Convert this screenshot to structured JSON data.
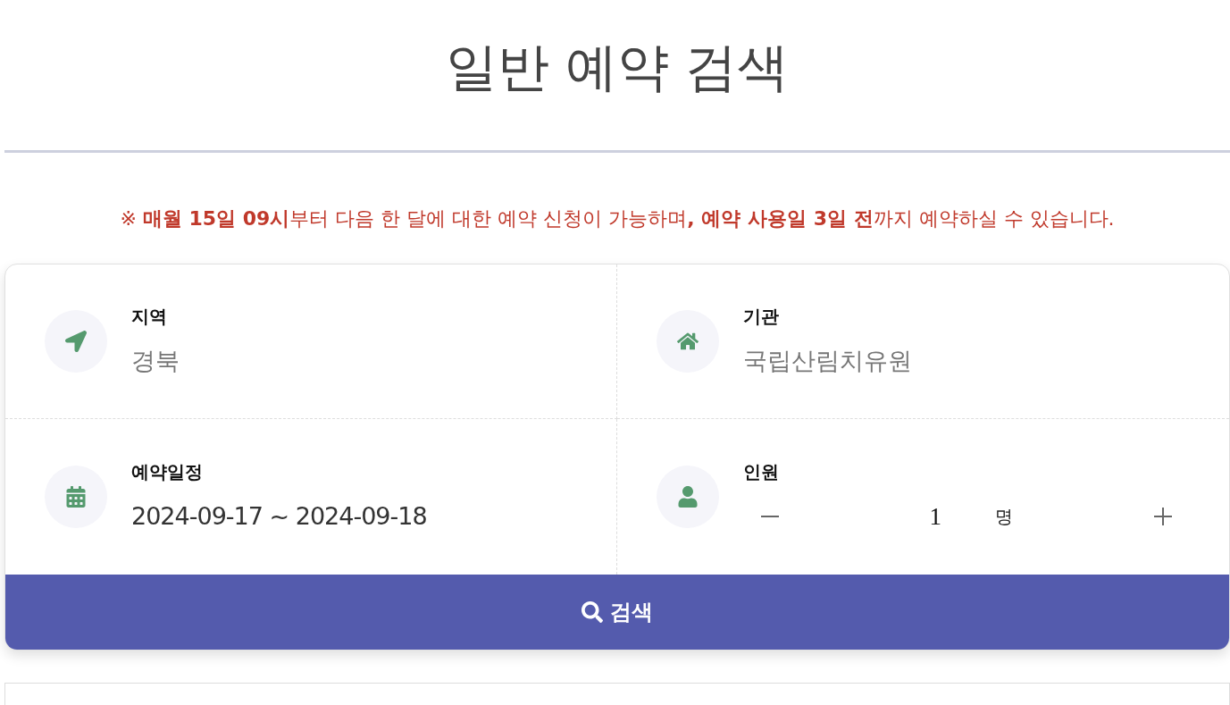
{
  "page_title": "일반 예약 검색",
  "notice": "※ **매월 15일 09시**부터 다음 한 달에 대한 예약 신청이 가능하며**, 예약 사용일 3일 전**까지 예약하실 수 있습니다.",
  "search_form": {
    "fields": [
      {
        "kind": "select",
        "label": "지역",
        "value": "경북"
      },
      {
        "kind": "select",
        "label": "기관",
        "value": "국립산림치유원"
      },
      {
        "kind": "date_range",
        "label": "예약일정",
        "value": "2024-09-17 ~ 2024-09-18"
      },
      {
        "kind": "counter",
        "label": "인원",
        "value": "1",
        "unit": "명"
      }
    ],
    "search_button": "검색"
  }
}
